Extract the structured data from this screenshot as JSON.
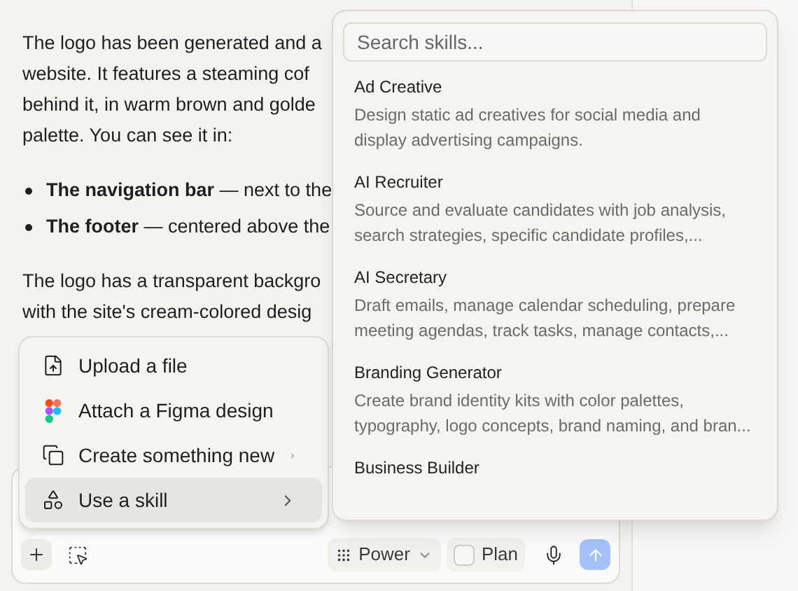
{
  "message": [
    {
      "kind": "text",
      "lines": [
        "The logo has been generated and a",
        "website. It features a steaming cof",
        "behind it, in warm brown and golde",
        "palette. You can see it in:"
      ]
    },
    {
      "kind": "bullets",
      "lines": [
        "**The navigation bar** — next to the",
        "**The footer** — centered above the"
      ]
    },
    {
      "kind": "text",
      "lines": [
        "The logo has a transparent backgro",
        "with the site's cream-colored desig"
      ]
    }
  ],
  "attach_menu": [
    {
      "label": "Upload a file",
      "submenu": false,
      "selected": false
    },
    {
      "label": "Attach a Figma design",
      "submenu": false,
      "selected": false
    },
    {
      "label": "Create something new",
      "submenu": true,
      "selected": false
    },
    {
      "label": "Use a skill",
      "submenu": true,
      "selected": true
    }
  ],
  "skills": {
    "search": {
      "placeholder": "Search skills..."
    },
    "items": [
      {
        "name": "Ad Creative",
        "description": "Design static ad creatives for social media and display advertising campaigns."
      },
      {
        "name": "AI Recruiter",
        "description": "Source and evaluate candidates with job analysis, search strategies, specific candidate profiles,..."
      },
      {
        "name": "AI Secretary",
        "description": "Draft emails, manage calendar scheduling, prepare meeting agendas, track tasks, manage contacts,..."
      },
      {
        "name": "Branding Generator",
        "description": "Create brand identity kits with color palettes, typography, logo concepts, brand naming, and bran..."
      },
      {
        "name": "Business Builder"
      }
    ]
  },
  "composer": {
    "mode": {
      "label": "Power"
    },
    "plan": {
      "label": "Plan",
      "checked": false
    },
    "send": {
      "disabled": true
    }
  }
}
